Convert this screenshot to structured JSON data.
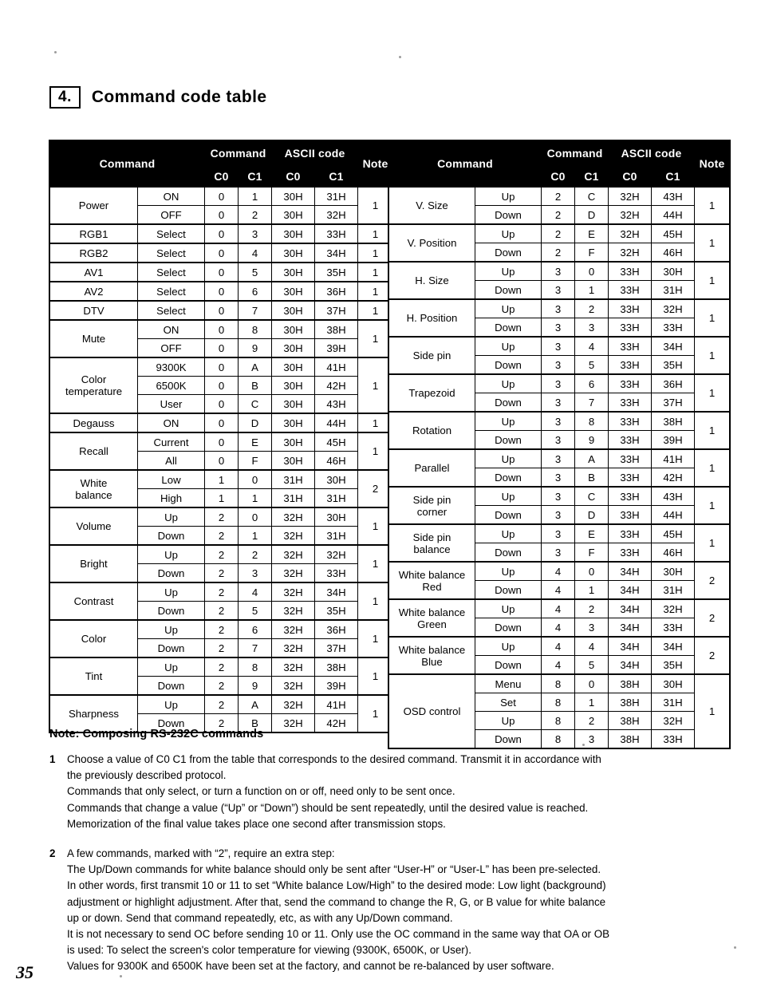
{
  "section": {
    "number": "4.",
    "title": "Command code table"
  },
  "table_headers": {
    "command": "Command",
    "command_group": "Command",
    "ascii_group": "ASCII code",
    "note": "Note",
    "c0": "C0",
    "c1": "C1"
  },
  "left_table": {
    "groups": [
      {
        "name": "Power",
        "note": "1",
        "rows": [
          {
            "sub": "ON",
            "c0": "0",
            "c1": "1",
            "a0": "30H",
            "a1": "31H"
          },
          {
            "sub": "OFF",
            "c0": "0",
            "c1": "2",
            "a0": "30H",
            "a1": "32H"
          }
        ]
      },
      {
        "name": "RGB1",
        "note": "1",
        "rows": [
          {
            "sub": "Select",
            "c0": "0",
            "c1": "3",
            "a0": "30H",
            "a1": "33H"
          }
        ]
      },
      {
        "name": "RGB2",
        "note": "1",
        "rows": [
          {
            "sub": "Select",
            "c0": "0",
            "c1": "4",
            "a0": "30H",
            "a1": "34H"
          }
        ]
      },
      {
        "name": "AV1",
        "note": "1",
        "rows": [
          {
            "sub": "Select",
            "c0": "0",
            "c1": "5",
            "a0": "30H",
            "a1": "35H"
          }
        ]
      },
      {
        "name": "AV2",
        "note": "1",
        "rows": [
          {
            "sub": "Select",
            "c0": "0",
            "c1": "6",
            "a0": "30H",
            "a1": "36H"
          }
        ]
      },
      {
        "name": "DTV",
        "note": "1",
        "rows": [
          {
            "sub": "Select",
            "c0": "0",
            "c1": "7",
            "a0": "30H",
            "a1": "37H"
          }
        ]
      },
      {
        "name": "Mute",
        "note": "1",
        "rows": [
          {
            "sub": "ON",
            "c0": "0",
            "c1": "8",
            "a0": "30H",
            "a1": "38H"
          },
          {
            "sub": "OFF",
            "c0": "0",
            "c1": "9",
            "a0": "30H",
            "a1": "39H"
          }
        ]
      },
      {
        "name": "Color temperature",
        "name_lines": [
          "Color",
          "temperature"
        ],
        "note": "1",
        "rows": [
          {
            "sub": "9300K",
            "c0": "0",
            "c1": "A",
            "a0": "30H",
            "a1": "41H"
          },
          {
            "sub": "6500K",
            "c0": "0",
            "c1": "B",
            "a0": "30H",
            "a1": "42H"
          },
          {
            "sub": "User",
            "c0": "0",
            "c1": "C",
            "a0": "30H",
            "a1": "43H"
          }
        ]
      },
      {
        "name": "Degauss",
        "note": "1",
        "rows": [
          {
            "sub": "ON",
            "c0": "0",
            "c1": "D",
            "a0": "30H",
            "a1": "44H"
          }
        ]
      },
      {
        "name": "Recall",
        "note": "1",
        "rows": [
          {
            "sub": "Current",
            "c0": "0",
            "c1": "E",
            "a0": "30H",
            "a1": "45H"
          },
          {
            "sub": "All",
            "c0": "0",
            "c1": "F",
            "a0": "30H",
            "a1": "46H"
          }
        ]
      },
      {
        "name": "White balance",
        "name_lines": [
          "White",
          "balance"
        ],
        "note": "2",
        "rows": [
          {
            "sub": "Low",
            "c0": "1",
            "c1": "0",
            "a0": "31H",
            "a1": "30H"
          },
          {
            "sub": "High",
            "c0": "1",
            "c1": "1",
            "a0": "31H",
            "a1": "31H"
          }
        ]
      },
      {
        "name": "Volume",
        "note": "1",
        "rows": [
          {
            "sub": "Up",
            "c0": "2",
            "c1": "0",
            "a0": "32H",
            "a1": "30H"
          },
          {
            "sub": "Down",
            "c0": "2",
            "c1": "1",
            "a0": "32H",
            "a1": "31H"
          }
        ]
      },
      {
        "name": "Bright",
        "note": "1",
        "rows": [
          {
            "sub": "Up",
            "c0": "2",
            "c1": "2",
            "a0": "32H",
            "a1": "32H"
          },
          {
            "sub": "Down",
            "c0": "2",
            "c1": "3",
            "a0": "32H",
            "a1": "33H"
          }
        ]
      },
      {
        "name": "Contrast",
        "note": "1",
        "rows": [
          {
            "sub": "Up",
            "c0": "2",
            "c1": "4",
            "a0": "32H",
            "a1": "34H"
          },
          {
            "sub": "Down",
            "c0": "2",
            "c1": "5",
            "a0": "32H",
            "a1": "35H"
          }
        ]
      },
      {
        "name": "Color",
        "note": "1",
        "rows": [
          {
            "sub": "Up",
            "c0": "2",
            "c1": "6",
            "a0": "32H",
            "a1": "36H"
          },
          {
            "sub": "Down",
            "c0": "2",
            "c1": "7",
            "a0": "32H",
            "a1": "37H"
          }
        ]
      },
      {
        "name": "Tint",
        "note": "1",
        "rows": [
          {
            "sub": "Up",
            "c0": "2",
            "c1": "8",
            "a0": "32H",
            "a1": "38H"
          },
          {
            "sub": "Down",
            "c0": "2",
            "c1": "9",
            "a0": "32H",
            "a1": "39H"
          }
        ]
      },
      {
        "name": "Sharpness",
        "note": "1",
        "rows": [
          {
            "sub": "Up",
            "c0": "2",
            "c1": "A",
            "a0": "32H",
            "a1": "41H"
          },
          {
            "sub": "Down",
            "c0": "2",
            "c1": "B",
            "a0": "32H",
            "a1": "42H"
          }
        ]
      }
    ]
  },
  "right_table": {
    "groups": [
      {
        "name": "V. Size",
        "note": "1",
        "rows": [
          {
            "sub": "Up",
            "c0": "2",
            "c1": "C",
            "a0": "32H",
            "a1": "43H"
          },
          {
            "sub": "Down",
            "c0": "2",
            "c1": "D",
            "a0": "32H",
            "a1": "44H"
          }
        ]
      },
      {
        "name": "V. Position",
        "note": "1",
        "rows": [
          {
            "sub": "Up",
            "c0": "2",
            "c1": "E",
            "a0": "32H",
            "a1": "45H"
          },
          {
            "sub": "Down",
            "c0": "2",
            "c1": "F",
            "a0": "32H",
            "a1": "46H"
          }
        ]
      },
      {
        "name": "H. Size",
        "note": "1",
        "rows": [
          {
            "sub": "Up",
            "c0": "3",
            "c1": "0",
            "a0": "33H",
            "a1": "30H"
          },
          {
            "sub": "Down",
            "c0": "3",
            "c1": "1",
            "a0": "33H",
            "a1": "31H"
          }
        ]
      },
      {
        "name": "H. Position",
        "note": "1",
        "rows": [
          {
            "sub": "Up",
            "c0": "3",
            "c1": "2",
            "a0": "33H",
            "a1": "32H"
          },
          {
            "sub": "Down",
            "c0": "3",
            "c1": "3",
            "a0": "33H",
            "a1": "33H"
          }
        ]
      },
      {
        "name": "Side pin",
        "note": "1",
        "rows": [
          {
            "sub": "Up",
            "c0": "3",
            "c1": "4",
            "a0": "33H",
            "a1": "34H"
          },
          {
            "sub": "Down",
            "c0": "3",
            "c1": "5",
            "a0": "33H",
            "a1": "35H"
          }
        ]
      },
      {
        "name": "Trapezoid",
        "note": "1",
        "rows": [
          {
            "sub": "Up",
            "c0": "3",
            "c1": "6",
            "a0": "33H",
            "a1": "36H"
          },
          {
            "sub": "Down",
            "c0": "3",
            "c1": "7",
            "a0": "33H",
            "a1": "37H"
          }
        ]
      },
      {
        "name": "Rotation",
        "note": "1",
        "rows": [
          {
            "sub": "Up",
            "c0": "3",
            "c1": "8",
            "a0": "33H",
            "a1": "38H"
          },
          {
            "sub": "Down",
            "c0": "3",
            "c1": "9",
            "a0": "33H",
            "a1": "39H"
          }
        ]
      },
      {
        "name": "Parallel",
        "note": "1",
        "rows": [
          {
            "sub": "Up",
            "c0": "3",
            "c1": "A",
            "a0": "33H",
            "a1": "41H"
          },
          {
            "sub": "Down",
            "c0": "3",
            "c1": "B",
            "a0": "33H",
            "a1": "42H"
          }
        ]
      },
      {
        "name": "Side pin corner",
        "name_lines": [
          "Side pin",
          "corner"
        ],
        "note": "1",
        "rows": [
          {
            "sub": "Up",
            "c0": "3",
            "c1": "C",
            "a0": "33H",
            "a1": "43H"
          },
          {
            "sub": "Down",
            "c0": "3",
            "c1": "D",
            "a0": "33H",
            "a1": "44H"
          }
        ]
      },
      {
        "name": "Side pin balance",
        "name_lines": [
          "Side pin",
          "balance"
        ],
        "note": "1",
        "rows": [
          {
            "sub": "Up",
            "c0": "3",
            "c1": "E",
            "a0": "33H",
            "a1": "45H"
          },
          {
            "sub": "Down",
            "c0": "3",
            "c1": "F",
            "a0": "33H",
            "a1": "46H"
          }
        ]
      },
      {
        "name": "White balance Red",
        "name_lines": [
          "White balance",
          "Red"
        ],
        "note": "2",
        "rows": [
          {
            "sub": "Up",
            "c0": "4",
            "c1": "0",
            "a0": "34H",
            "a1": "30H"
          },
          {
            "sub": "Down",
            "c0": "4",
            "c1": "1",
            "a0": "34H",
            "a1": "31H"
          }
        ]
      },
      {
        "name": "White balance Green",
        "name_lines": [
          "White balance",
          "Green"
        ],
        "note": "2",
        "rows": [
          {
            "sub": "Up",
            "c0": "4",
            "c1": "2",
            "a0": "34H",
            "a1": "32H"
          },
          {
            "sub": "Down",
            "c0": "4",
            "c1": "3",
            "a0": "34H",
            "a1": "33H"
          }
        ]
      },
      {
        "name": "White balance Blue",
        "name_lines": [
          "White balance",
          "Blue"
        ],
        "note": "2",
        "rows": [
          {
            "sub": "Up",
            "c0": "4",
            "c1": "4",
            "a0": "34H",
            "a1": "34H"
          },
          {
            "sub": "Down",
            "c0": "4",
            "c1": "5",
            "a0": "34H",
            "a1": "35H"
          }
        ]
      },
      {
        "name": "OSD control",
        "note": "1",
        "rows": [
          {
            "sub": "Menu",
            "c0": "8",
            "c1": "0",
            "a0": "38H",
            "a1": "30H"
          },
          {
            "sub": "Set",
            "c0": "8",
            "c1": "1",
            "a0": "38H",
            "a1": "31H"
          },
          {
            "sub": "Up",
            "c0": "8",
            "c1": "2",
            "a0": "38H",
            "a1": "32H"
          },
          {
            "sub": "Down",
            "c0": "8",
            "c1": "3",
            "a0": "38H",
            "a1": "33H"
          }
        ]
      }
    ]
  },
  "notes": {
    "heading": "Note: Composing RS-232C commands",
    "items": [
      {
        "number": "1",
        "lines": [
          "Choose a value of C0 C1 from the table that corresponds to the desired command. Transmit it in accordance with",
          "the previously described protocol.",
          "Commands that only select, or turn a function on or off, need only to be sent once.",
          "Commands that change a value (“Up” or “Down”) should be sent repeatedly, until the desired value is reached.",
          "Memorization of the final value takes place one second after transmission stops."
        ]
      },
      {
        "number": "2",
        "lines": [
          "A few commands, marked with “2”, require an extra step:",
          "The Up/Down commands for white balance should only be sent after “User-H” or “User-L” has been pre-selected.",
          "In other words, first transmit 10 or 11 to set “White balance Low/High” to the desired mode: Low light (background)",
          "adjustment or highlight adjustment. After that, send the command to change the R, G, or B value for white balance",
          "up or down. Send that command repeatedly, etc, as with any Up/Down command.",
          "It is not necessary to send OC before sending 10 or 11. Only use the OC command in the same way that OA or OB",
          "is used: To select the screen's color temperature for viewing (9300K, 6500K, or User).",
          "Values for 9300K and 6500K have been set at the factory, and cannot be re-balanced by user software."
        ]
      }
    ]
  },
  "page_number": "35"
}
